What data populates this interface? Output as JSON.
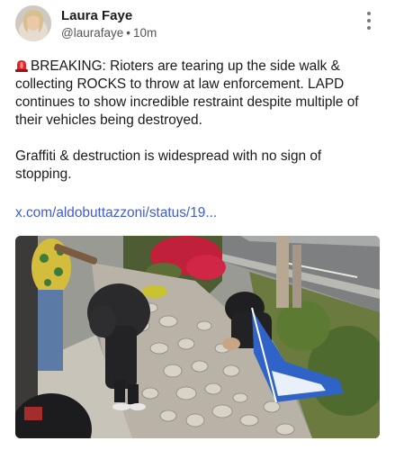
{
  "post": {
    "author_name": "Laura Faye",
    "handle": "@laurafaye",
    "time": "10m",
    "separator": "•",
    "paragraph_1": "BREAKING: Rioters are tearing up the side walk & collecting ROCKS to throw at law enforcement. LAPD continues to show incredible restraint despite multiple of their vehicles being destroyed.",
    "paragraph_2": "Graffiti & destruction is widespread with no sign of stopping.",
    "link_text": "x.com/aldobuttazzoni/status/19...",
    "emoji": "police-siren-icon",
    "media": "photo"
  },
  "colors": {
    "link": "#3d5bd9",
    "text": "#1a1a1a",
    "muted": "#555555"
  }
}
